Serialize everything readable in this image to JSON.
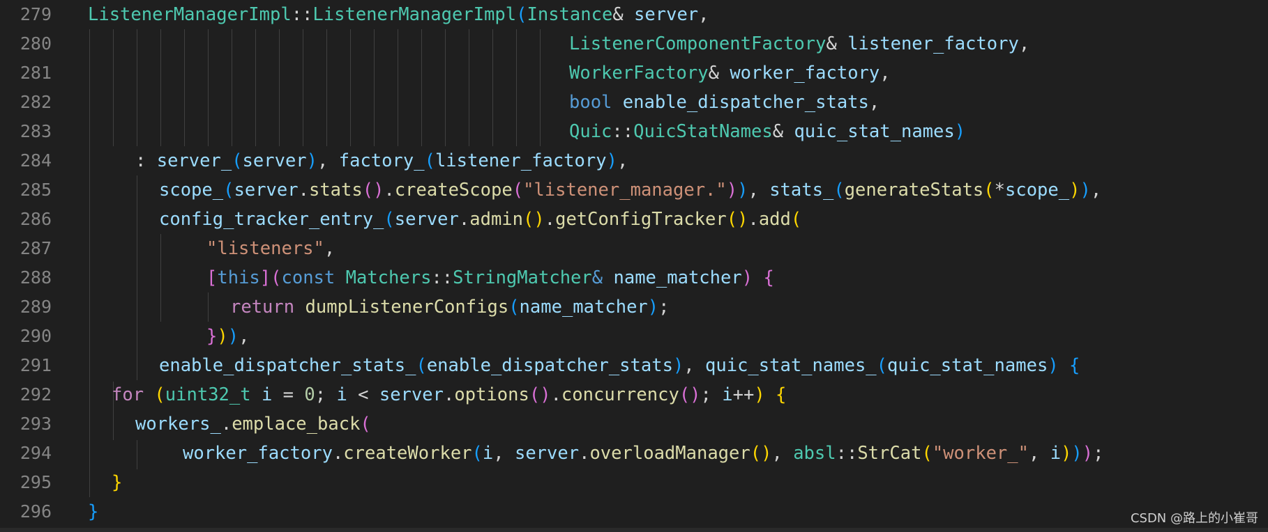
{
  "editor": {
    "theme": {
      "background": "#1f1f1f",
      "line_number_color": "#858585"
    },
    "lines": [
      {
        "number": "279",
        "tokens": [
          {
            "t": "ListenerManagerImpl",
            "c": "ty"
          },
          {
            "t": "::",
            "c": "p"
          },
          {
            "t": "ListenerManagerImpl",
            "c": "ty"
          },
          {
            "t": "(",
            "c": "b3"
          },
          {
            "t": "Instance",
            "c": "ty"
          },
          {
            "t": "& ",
            "c": "p"
          },
          {
            "t": "server",
            "c": "id"
          },
          {
            "t": ",",
            "c": "p"
          }
        ]
      },
      {
        "number": "280",
        "tokens": [
          {
            "t": "ListenerComponentFactory",
            "c": "ty"
          },
          {
            "t": "& ",
            "c": "p"
          },
          {
            "t": "listener_factory",
            "c": "id"
          },
          {
            "t": ",",
            "c": "p"
          }
        ]
      },
      {
        "number": "281",
        "tokens": [
          {
            "t": "WorkerFactory",
            "c": "ty"
          },
          {
            "t": "& ",
            "c": "p"
          },
          {
            "t": "worker_factory",
            "c": "id"
          },
          {
            "t": ",",
            "c": "p"
          }
        ]
      },
      {
        "number": "282",
        "tokens": [
          {
            "t": "bool",
            "c": "kw"
          },
          {
            "t": " ",
            "c": "p"
          },
          {
            "t": "enable_dispatcher_stats",
            "c": "id"
          },
          {
            "t": ",",
            "c": "p"
          }
        ]
      },
      {
        "number": "283",
        "tokens": [
          {
            "t": "Quic",
            "c": "ty"
          },
          {
            "t": "::",
            "c": "p"
          },
          {
            "t": "QuicStatNames",
            "c": "ty"
          },
          {
            "t": "& ",
            "c": "p"
          },
          {
            "t": "quic_stat_names",
            "c": "id"
          },
          {
            "t": ")",
            "c": "b3"
          }
        ]
      },
      {
        "number": "284",
        "tokens": [
          {
            "t": ": ",
            "c": "p"
          },
          {
            "t": "server_",
            "c": "id"
          },
          {
            "t": "(",
            "c": "b3"
          },
          {
            "t": "server",
            "c": "id"
          },
          {
            "t": ")",
            "c": "b3"
          },
          {
            "t": ", ",
            "c": "p"
          },
          {
            "t": "factory_",
            "c": "id"
          },
          {
            "t": "(",
            "c": "b3"
          },
          {
            "t": "listener_factory",
            "c": "id"
          },
          {
            "t": ")",
            "c": "b3"
          },
          {
            "t": ",",
            "c": "p"
          }
        ]
      },
      {
        "number": "285",
        "tokens": [
          {
            "t": "scope_",
            "c": "id"
          },
          {
            "t": "(",
            "c": "b3"
          },
          {
            "t": "server",
            "c": "id"
          },
          {
            "t": ".",
            "c": "p"
          },
          {
            "t": "stats",
            "c": "fn"
          },
          {
            "t": "()",
            "c": "b2"
          },
          {
            "t": ".",
            "c": "p"
          },
          {
            "t": "createScope",
            "c": "fn"
          },
          {
            "t": "(",
            "c": "b2"
          },
          {
            "t": "\"listener_manager.\"",
            "c": "str"
          },
          {
            "t": ")",
            "c": "b2"
          },
          {
            "t": ")",
            "c": "b3"
          },
          {
            "t": ", ",
            "c": "p"
          },
          {
            "t": "stats_",
            "c": "id"
          },
          {
            "t": "(",
            "c": "b3"
          },
          {
            "t": "generateStats",
            "c": "fn"
          },
          {
            "t": "(",
            "c": "b1"
          },
          {
            "t": "*",
            "c": "p"
          },
          {
            "t": "scope_",
            "c": "id"
          },
          {
            "t": ")",
            "c": "b1"
          },
          {
            "t": ")",
            "c": "b3"
          },
          {
            "t": ",",
            "c": "p"
          }
        ]
      },
      {
        "number": "286",
        "tokens": [
          {
            "t": "config_tracker_entry_",
            "c": "id"
          },
          {
            "t": "(",
            "c": "b3"
          },
          {
            "t": "server",
            "c": "id"
          },
          {
            "t": ".",
            "c": "p"
          },
          {
            "t": "admin",
            "c": "fn"
          },
          {
            "t": "()",
            "c": "b1"
          },
          {
            "t": ".",
            "c": "p"
          },
          {
            "t": "getConfigTracker",
            "c": "fn"
          },
          {
            "t": "()",
            "c": "b1"
          },
          {
            "t": ".",
            "c": "p"
          },
          {
            "t": "add",
            "c": "fn"
          },
          {
            "t": "(",
            "c": "b1"
          }
        ]
      },
      {
        "number": "287",
        "tokens": [
          {
            "t": "\"listeners\"",
            "c": "str"
          },
          {
            "t": ",",
            "c": "p"
          }
        ]
      },
      {
        "number": "288",
        "tokens": [
          {
            "t": "[",
            "c": "b2"
          },
          {
            "t": "this",
            "c": "kw"
          },
          {
            "t": "]",
            "c": "b2"
          },
          {
            "t": "(",
            "c": "b2"
          },
          {
            "t": "const",
            "c": "kw"
          },
          {
            "t": " ",
            "c": "p"
          },
          {
            "t": "Matchers",
            "c": "ty"
          },
          {
            "t": "::",
            "c": "p"
          },
          {
            "t": "StringMatcher",
            "c": "ty"
          },
          {
            "t": "&",
            "c": "kw"
          },
          {
            "t": " ",
            "c": "p"
          },
          {
            "t": "name_matcher",
            "c": "id"
          },
          {
            "t": ")",
            "c": "b2"
          },
          {
            "t": " ",
            "c": "p"
          },
          {
            "t": "{",
            "c": "b2"
          }
        ]
      },
      {
        "number": "289",
        "tokens": [
          {
            "t": "return",
            "c": "ctl"
          },
          {
            "t": " ",
            "c": "p"
          },
          {
            "t": "dumpListenerConfigs",
            "c": "fn"
          },
          {
            "t": "(",
            "c": "b3"
          },
          {
            "t": "name_matcher",
            "c": "id"
          },
          {
            "t": ")",
            "c": "b3"
          },
          {
            "t": ";",
            "c": "p"
          }
        ]
      },
      {
        "number": "290",
        "tokens": [
          {
            "t": "}",
            "c": "b2"
          },
          {
            "t": ")",
            "c": "b1"
          },
          {
            "t": ")",
            "c": "b3"
          },
          {
            "t": ",",
            "c": "p"
          }
        ]
      },
      {
        "number": "291",
        "tokens": [
          {
            "t": "enable_dispatcher_stats_",
            "c": "id"
          },
          {
            "t": "(",
            "c": "b3"
          },
          {
            "t": "enable_dispatcher_stats",
            "c": "id"
          },
          {
            "t": ")",
            "c": "b3"
          },
          {
            "t": ", ",
            "c": "p"
          },
          {
            "t": "quic_stat_names_",
            "c": "id"
          },
          {
            "t": "(",
            "c": "b3"
          },
          {
            "t": "quic_stat_names",
            "c": "id"
          },
          {
            "t": ")",
            "c": "b3"
          },
          {
            "t": " ",
            "c": "p"
          },
          {
            "t": "{",
            "c": "b3"
          }
        ]
      },
      {
        "number": "292",
        "tokens": [
          {
            "t": "for",
            "c": "ctl"
          },
          {
            "t": " ",
            "c": "p"
          },
          {
            "t": "(",
            "c": "b1"
          },
          {
            "t": "uint32_t",
            "c": "ty"
          },
          {
            "t": " ",
            "c": "p"
          },
          {
            "t": "i",
            "c": "id"
          },
          {
            "t": " = ",
            "c": "p"
          },
          {
            "t": "0",
            "c": "num"
          },
          {
            "t": "; ",
            "c": "p"
          },
          {
            "t": "i",
            "c": "id"
          },
          {
            "t": " < ",
            "c": "p"
          },
          {
            "t": "server",
            "c": "id"
          },
          {
            "t": ".",
            "c": "p"
          },
          {
            "t": "options",
            "c": "fn"
          },
          {
            "t": "()",
            "c": "b2"
          },
          {
            "t": ".",
            "c": "p"
          },
          {
            "t": "concurrency",
            "c": "fn"
          },
          {
            "t": "()",
            "c": "b2"
          },
          {
            "t": "; ",
            "c": "p"
          },
          {
            "t": "i",
            "c": "id"
          },
          {
            "t": "++",
            "c": "p"
          },
          {
            "t": ")",
            "c": "b1"
          },
          {
            "t": " ",
            "c": "p"
          },
          {
            "t": "{",
            "c": "b1"
          }
        ]
      },
      {
        "number": "293",
        "tokens": [
          {
            "t": "workers_",
            "c": "id"
          },
          {
            "t": ".",
            "c": "p"
          },
          {
            "t": "emplace_back",
            "c": "fn"
          },
          {
            "t": "(",
            "c": "b2"
          }
        ]
      },
      {
        "number": "294",
        "tokens": [
          {
            "t": "worker_factory",
            "c": "id"
          },
          {
            "t": ".",
            "c": "p"
          },
          {
            "t": "createWorker",
            "c": "fn"
          },
          {
            "t": "(",
            "c": "b3"
          },
          {
            "t": "i",
            "c": "id"
          },
          {
            "t": ", ",
            "c": "p"
          },
          {
            "t": "server",
            "c": "id"
          },
          {
            "t": ".",
            "c": "p"
          },
          {
            "t": "overloadManager",
            "c": "fn"
          },
          {
            "t": "()",
            "c": "b1"
          },
          {
            "t": ", ",
            "c": "p"
          },
          {
            "t": "absl",
            "c": "ty"
          },
          {
            "t": "::",
            "c": "p"
          },
          {
            "t": "StrCat",
            "c": "fn"
          },
          {
            "t": "(",
            "c": "b1"
          },
          {
            "t": "\"worker_\"",
            "c": "str"
          },
          {
            "t": ", ",
            "c": "p"
          },
          {
            "t": "i",
            "c": "id"
          },
          {
            "t": ")",
            "c": "b1"
          },
          {
            "t": ")",
            "c": "b3"
          },
          {
            "t": ")",
            "c": "b2"
          },
          {
            "t": ";",
            "c": "p"
          }
        ]
      },
      {
        "number": "295",
        "tokens": [
          {
            "t": "}",
            "c": "b1"
          }
        ]
      },
      {
        "number": "296",
        "tokens": [
          {
            "t": "}",
            "c": "b3"
          }
        ]
      }
    ]
  },
  "watermark": "CSDN @路上的小崔哥"
}
